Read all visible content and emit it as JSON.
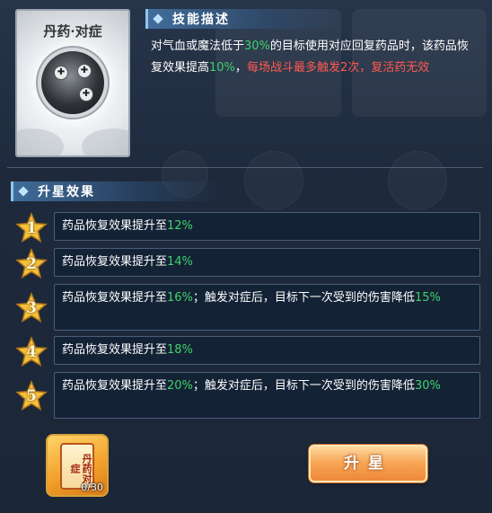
{
  "skill": {
    "name": "丹药·对症",
    "emblem_icon": "medicine-emblem-icon"
  },
  "description": {
    "title": "技能描述",
    "seg1": "对气血或魔法低于",
    "seg2": "30%",
    "seg3": "的目标使用对应回复药品时，该药品恢复效果提高",
    "seg4": "10%",
    "seg5": "，",
    "seg6": "每场战斗最多触发2次，复活药无效"
  },
  "star_effects": {
    "title": "升星效果",
    "items": [
      {
        "level": "1",
        "text": "药品恢复效果提升至",
        "value": "12%",
        "text2": "",
        "value2": ""
      },
      {
        "level": "2",
        "text": "药品恢复效果提升至",
        "value": "14%",
        "text2": "",
        "value2": ""
      },
      {
        "level": "3",
        "text": "药品恢复效果提升至",
        "value": "16%",
        "text2": "；触发对症后，目标下一次受到的伤害降低",
        "value2": "15%"
      },
      {
        "level": "4",
        "text": "药品恢复效果提升至",
        "value": "18%",
        "text2": "",
        "value2": ""
      },
      {
        "level": "5",
        "text": "药品恢复效果提升至",
        "value": "20%",
        "text2": "；触发对症后，目标下一次受到的伤害降低",
        "value2": "30%"
      }
    ]
  },
  "item": {
    "label": "丹药对症",
    "count": "0/30",
    "icon": "scroll-icon"
  },
  "upgrade_button": {
    "label": "升星"
  },
  "colors": {
    "highlight_green": "#3fd26a",
    "highlight_red": "#ff5a4f",
    "background": "#1e2a3c"
  }
}
